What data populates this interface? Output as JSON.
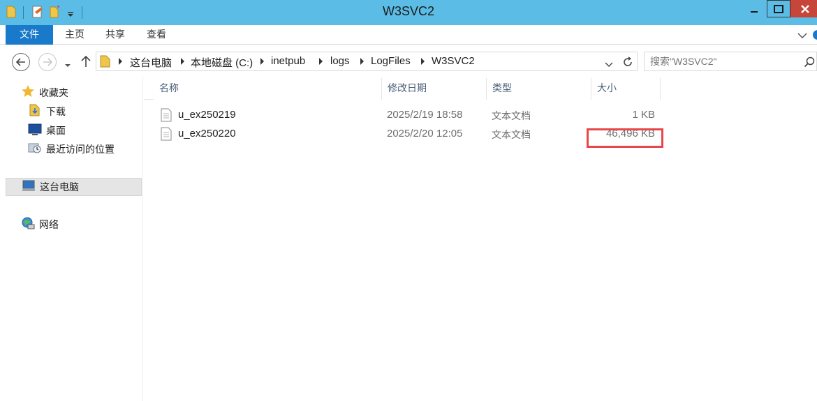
{
  "window": {
    "title": "W3SVC2",
    "controls": [
      "minimize",
      "maximize",
      "close"
    ]
  },
  "ribbon": {
    "tabs": [
      {
        "label": "文件",
        "active": true
      },
      {
        "label": "主页",
        "active": false
      },
      {
        "label": "共享",
        "active": false
      },
      {
        "label": "查看",
        "active": false
      }
    ]
  },
  "address": {
    "crumbs": [
      "这台电脑",
      "本地磁盘 (C:)",
      "inetpub",
      "logs",
      "LogFiles",
      "W3SVC2"
    ]
  },
  "search": {
    "placeholder": "搜索\"W3SVC2\""
  },
  "sidebar": {
    "favorites_label": "收藏夹",
    "favorites": [
      "下载",
      "桌面",
      "最近访问的位置"
    ],
    "thispc_label": "这台电脑",
    "network_label": "网络"
  },
  "columns": {
    "name": "名称",
    "date": "修改日期",
    "type": "类型",
    "size": "大小"
  },
  "files": [
    {
      "name": "u_ex250219",
      "date": "2025/2/19 18:58",
      "type": "文本文档",
      "size": "1 KB"
    },
    {
      "name": "u_ex250220",
      "date": "2025/2/20 12:05",
      "type": "文本文档",
      "size": "46,496 KB",
      "highlighted": true
    }
  ],
  "colors": {
    "titlebar": "#5bbde6",
    "file_tab": "#1979ca",
    "highlight": "#e8474a"
  }
}
